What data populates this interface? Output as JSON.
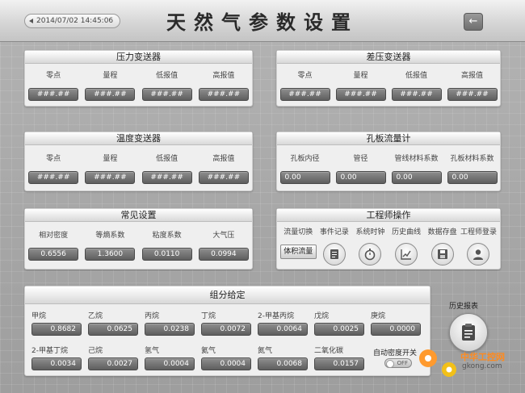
{
  "header": {
    "datetime": "2014/07/02 14:45:06",
    "title": "天然气参数设置",
    "back_icon": "arrow-left-icon"
  },
  "pressure": {
    "title": "压力变送器",
    "fields": [
      {
        "label": "零点",
        "value": "###.##"
      },
      {
        "label": "量程",
        "value": "###.##"
      },
      {
        "label": "低报值",
        "value": "###.##"
      },
      {
        "label": "高报值",
        "value": "###.##"
      }
    ]
  },
  "diff_pressure": {
    "title": "差压变送器",
    "fields": [
      {
        "label": "零点",
        "value": "###.##"
      },
      {
        "label": "量程",
        "value": "###.##"
      },
      {
        "label": "低报值",
        "value": "###.##"
      },
      {
        "label": "高报值",
        "value": "###.##"
      }
    ]
  },
  "temperature": {
    "title": "温度变送器",
    "fields": [
      {
        "label": "零点",
        "value": "###.##"
      },
      {
        "label": "量程",
        "value": "###.##"
      },
      {
        "label": "低报值",
        "value": "###.##"
      },
      {
        "label": "高报值",
        "value": "###.##"
      }
    ]
  },
  "orifice": {
    "title": "孔板流量计",
    "fields": [
      {
        "label": "孔板内径",
        "value": "0.00"
      },
      {
        "label": "管径",
        "value": "0.00"
      },
      {
        "label": "管线材料系数",
        "value": "0.00"
      },
      {
        "label": "孔板材料系数",
        "value": "0.00"
      }
    ]
  },
  "common": {
    "title": "常见设置",
    "fields": [
      {
        "label": "相对密度",
        "value": "0.6556"
      },
      {
        "label": "等熵系数",
        "value": "1.3600"
      },
      {
        "label": "粘度系数",
        "value": "0.0110"
      },
      {
        "label": "大气压",
        "value": "0.0994"
      }
    ]
  },
  "engineer": {
    "title": "工程师操作",
    "items": [
      {
        "label": "流量切换",
        "button": "体积流量"
      },
      {
        "label": "事件记录",
        "icon": "notepad-icon"
      },
      {
        "label": "系统时钟",
        "icon": "stopwatch-icon"
      },
      {
        "label": "历史曲线",
        "icon": "line-chart-icon"
      },
      {
        "label": "数据存盘",
        "icon": "floppy-disk-icon"
      },
      {
        "label": "工程师登录",
        "icon": "user-icon"
      }
    ]
  },
  "composition": {
    "title": "组分给定",
    "rows": [
      [
        {
          "label": "甲烷",
          "value": "0.8682"
        },
        {
          "label": "乙烷",
          "value": "0.0625"
        },
        {
          "label": "丙烷",
          "value": "0.0238"
        },
        {
          "label": "丁烷",
          "value": "0.0072"
        },
        {
          "label": "2-甲基丙烷",
          "value": "0.0064"
        },
        {
          "label": "戊烷",
          "value": "0.0025"
        },
        {
          "label": "庚烷",
          "value": "0.0000"
        }
      ],
      [
        {
          "label": "2-甲基丁烷",
          "value": "0.0034"
        },
        {
          "label": "己烷",
          "value": "0.0027"
        },
        {
          "label": "氢气",
          "value": "0.0004"
        },
        {
          "label": "氦气",
          "value": "0.0004"
        },
        {
          "label": "氮气",
          "value": "0.0068"
        },
        {
          "label": "二氧化碳",
          "value": "0.0157"
        }
      ]
    ]
  },
  "history": {
    "label": "历史报表",
    "icon": "report-icon"
  },
  "auto_density": {
    "label": "自动密度开关",
    "state": "OFF"
  },
  "watermark": {
    "name": "中华工控网",
    "url": "gkong.com"
  },
  "colors": {
    "accent": "#ff8a1e",
    "value_box": "#6e6e6e"
  }
}
